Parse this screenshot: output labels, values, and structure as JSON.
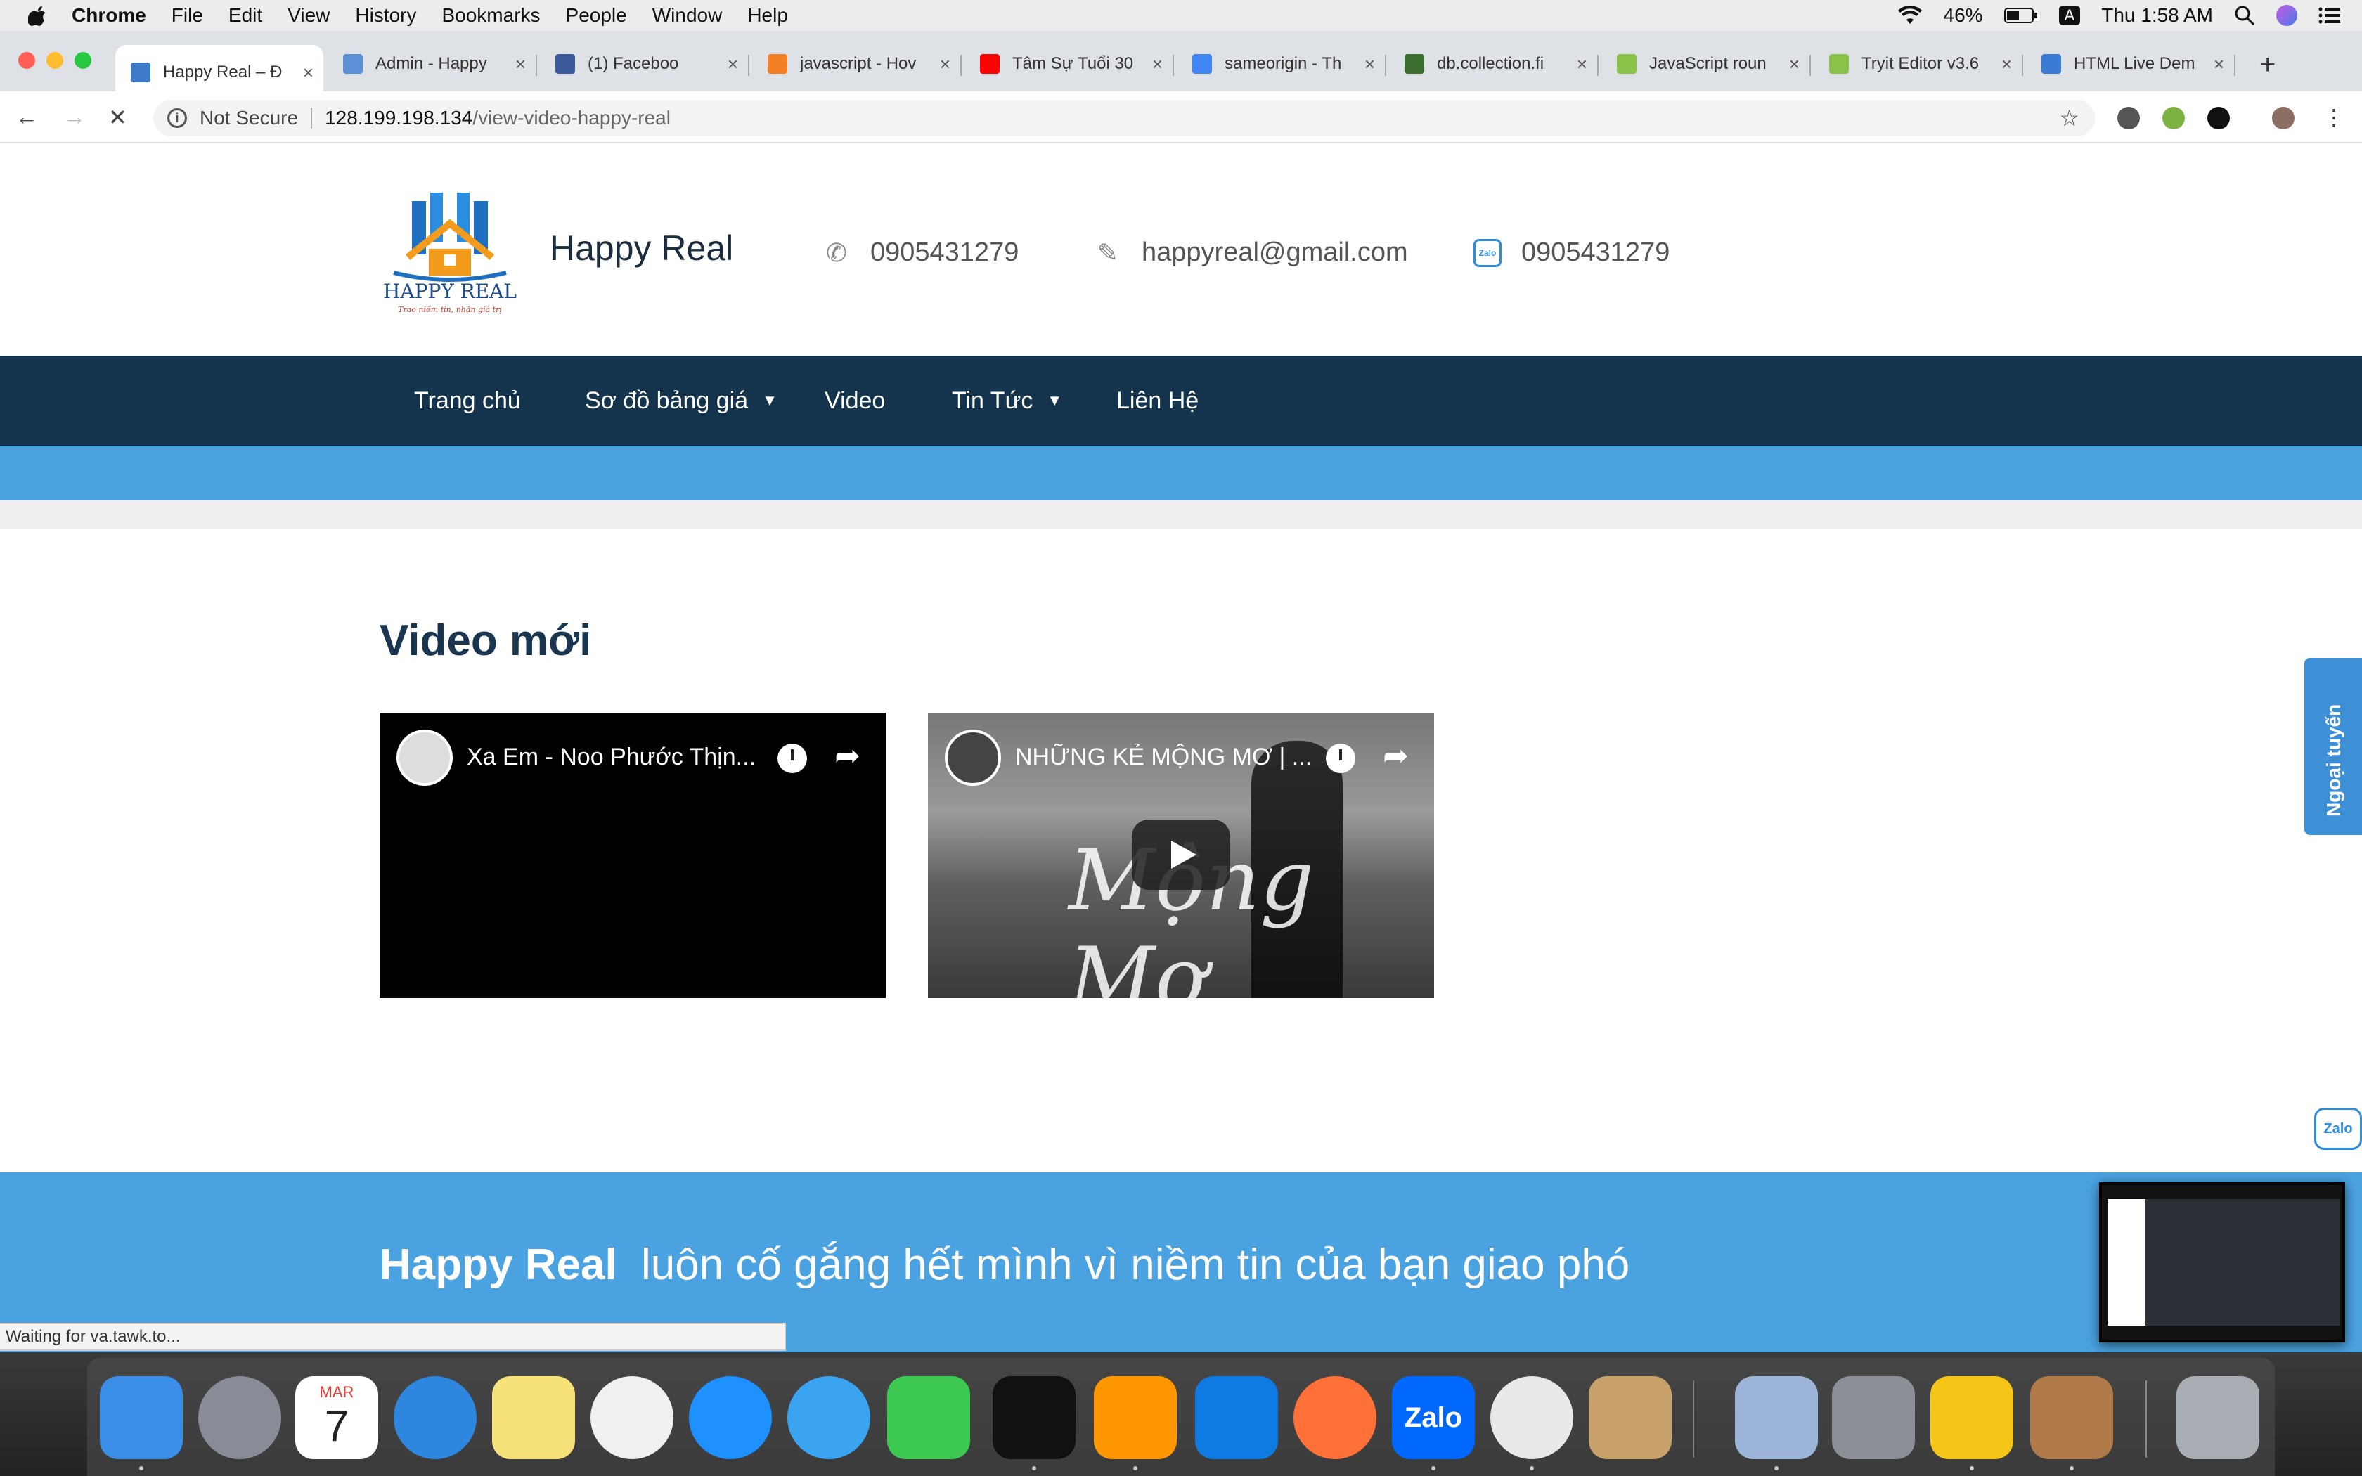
{
  "menubar": {
    "app": "Chrome",
    "items": [
      "File",
      "Edit",
      "View",
      "History",
      "Bookmarks",
      "People",
      "Window",
      "Help"
    ],
    "battery": "46%",
    "input_source": "A",
    "clock": "Thu 1:58 AM"
  },
  "tabs": [
    {
      "title": "Happy Real – Đ",
      "active": true,
      "favicon_color": "#3d7ac8"
    },
    {
      "title": "Admin - Happy",
      "active": false,
      "favicon_color": "#5b8fd6"
    },
    {
      "title": "(1) Faceboo",
      "active": false,
      "favicon_color": "#3b5998"
    },
    {
      "title": "javascript - Hov",
      "active": false,
      "favicon_color": "#f48024"
    },
    {
      "title": "Tâm Sự Tuổi 30",
      "active": false,
      "favicon_color": "#ff0000"
    },
    {
      "title": "sameorigin - Th",
      "active": false,
      "favicon_color": "#4285f4"
    },
    {
      "title": "db.collection.fi",
      "active": false,
      "favicon_color": "#3b6e2f"
    },
    {
      "title": "JavaScript roun",
      "active": false,
      "favicon_color": "#8bc34a"
    },
    {
      "title": "Tryit Editor v3.6",
      "active": false,
      "favicon_color": "#8bc34a"
    },
    {
      "title": "HTML Live Dem",
      "active": false,
      "favicon_color": "#3a7bd5"
    }
  ],
  "toolbar": {
    "security_label": "Not Secure",
    "url_host": "128.199.198.134",
    "url_path": "/view-video-happy-real"
  },
  "site": {
    "logo_text": "HAPPY REAL",
    "logo_slogan": "Trao niềm tin, nhận giá trị",
    "title": "Happy Real",
    "phone": "0905431279",
    "email": "happyreal@gmail.com",
    "zalo": "0905431279",
    "zalo_icon_label": "Zalo"
  },
  "nav": [
    {
      "label": "Trang chủ",
      "dropdown": false
    },
    {
      "label": "Sơ đồ bảng giá",
      "dropdown": true
    },
    {
      "label": "Video",
      "dropdown": false
    },
    {
      "label": "Tin Tức",
      "dropdown": true
    },
    {
      "label": "Liên Hệ",
      "dropdown": false
    }
  ],
  "main": {
    "section_title": "Video mới",
    "videos": [
      {
        "title": "Xa Em - Noo Phước Thịn..."
      },
      {
        "title": "NHỮNG KẺ MỘNG MƠ | ...",
        "overlay_text": "Mộng Mơ"
      }
    ]
  },
  "side_tab": "Ngoại tuyến",
  "zalo_float": "Zalo",
  "footer": {
    "brand": "Happy Real",
    "tagline": "luôn cố gắng hết mình vì niềm tin của bạn giao phó"
  },
  "status_bar": "Waiting for va.tawk.to...",
  "dock": [
    {
      "name": "finder",
      "color": "#3a8ee6"
    },
    {
      "name": "launchpad",
      "color": "#888c96"
    },
    {
      "name": "calendar",
      "color": "#ffffff",
      "month": "MAR",
      "day": "7"
    },
    {
      "name": "safari",
      "color": "#2e86de"
    },
    {
      "name": "notes",
      "color": "#f7e27a"
    },
    {
      "name": "photos",
      "color": "#f0f0f0"
    },
    {
      "name": "app-store",
      "color": "#1e90ff"
    },
    {
      "name": "messages",
      "color": "#3ba4f0"
    },
    {
      "name": "facetime",
      "color": "#3ec952"
    },
    {
      "name": "terminal",
      "color": "#111111"
    },
    {
      "name": "sublime-text",
      "color": "#ff9800"
    },
    {
      "name": "teamviewer",
      "color": "#0e7ae2"
    },
    {
      "name": "firefox",
      "color": "#ff7139"
    },
    {
      "name": "zalo",
      "color": "#0068ff"
    },
    {
      "name": "chrome",
      "color": "#e8e8e8"
    },
    {
      "name": "paintbrush",
      "color": "#c8a26a"
    },
    {
      "name": "mail",
      "color": "#9bb4d8"
    },
    {
      "name": "system-preferences",
      "color": "#8a8f98"
    },
    {
      "name": "cyberduck",
      "color": "#f5c518"
    },
    {
      "name": "calculator",
      "color": "#b07a4a"
    },
    {
      "name": "trash",
      "color": "#a8adb4"
    }
  ]
}
